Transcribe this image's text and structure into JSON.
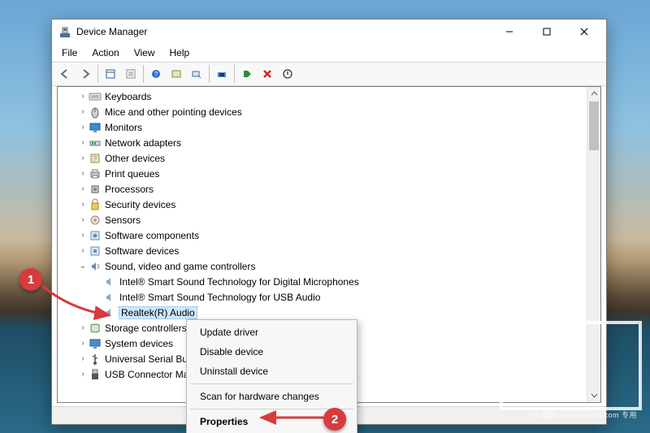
{
  "window": {
    "title": "Device Manager",
    "controls": {
      "minimize": "Minimize",
      "maximize": "Maximize",
      "close": "Close"
    }
  },
  "menubar": [
    "File",
    "Action",
    "View",
    "Help"
  ],
  "tree": {
    "categories": [
      {
        "label": "Keyboards",
        "icon": "keyboard"
      },
      {
        "label": "Mice and other pointing devices",
        "icon": "mouse"
      },
      {
        "label": "Monitors",
        "icon": "monitor"
      },
      {
        "label": "Network adapters",
        "icon": "network"
      },
      {
        "label": "Other devices",
        "icon": "other"
      },
      {
        "label": "Print queues",
        "icon": "printer"
      },
      {
        "label": "Processors",
        "icon": "cpu"
      },
      {
        "label": "Security devices",
        "icon": "security"
      },
      {
        "label": "Sensors",
        "icon": "sensor"
      },
      {
        "label": "Software components",
        "icon": "software"
      },
      {
        "label": "Software devices",
        "icon": "software"
      },
      {
        "label": "Sound, video and game controllers",
        "icon": "sound",
        "expanded": true,
        "children": [
          {
            "label": "Intel® Smart Sound Technology for Digital Microphones"
          },
          {
            "label": "Intel® Smart Sound Technology for USB Audio"
          },
          {
            "label": "Realtek(R) Audio",
            "selected": true
          }
        ]
      },
      {
        "label": "Storage controllers",
        "icon": "storage"
      },
      {
        "label": "System devices",
        "icon": "system"
      },
      {
        "label": "Universal Serial Bus",
        "icon": "usb",
        "truncated": true
      },
      {
        "label": "USB Connector Manage",
        "icon": "usb-connector",
        "truncated": true
      }
    ]
  },
  "context_menu": {
    "items": [
      {
        "label": "Update driver"
      },
      {
        "label": "Disable device"
      },
      {
        "label": "Uninstall device"
      },
      {
        "separator": true
      },
      {
        "label": "Scan for hardware changes"
      },
      {
        "separator": true
      },
      {
        "label": "Properties",
        "bold": true
      }
    ]
  },
  "annotations": {
    "badge1": "1",
    "badge2": "2"
  },
  "watermark": "小闻网 www.xwenw.com 专用"
}
